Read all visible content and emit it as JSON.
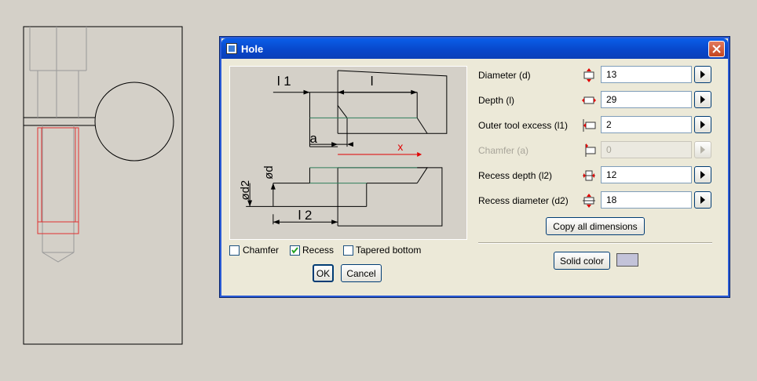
{
  "dialog": {
    "title": "Hole",
    "close_label": "×"
  },
  "preview": {
    "labels": {
      "l1": "l 1",
      "l": "l",
      "a": "a",
      "x": "x",
      "d": "ød",
      "d2": "ød2",
      "l2": "l 2"
    }
  },
  "options": {
    "chamfer": {
      "label": "Chamfer",
      "checked": false
    },
    "recess": {
      "label": "Recess",
      "checked": true
    },
    "tapered": {
      "label": "Tapered bottom",
      "checked": false
    }
  },
  "buttons": {
    "ok": "OK",
    "cancel": "Cancel",
    "copy_all": "Copy all dimensions",
    "solid_color": "Solid color"
  },
  "params": {
    "diameter": {
      "label": "Diameter (d)",
      "value": "13"
    },
    "depth": {
      "label": "Depth (l)",
      "value": "29"
    },
    "outer_tool_excess": {
      "label": "Outer tool excess (l1)",
      "value": "2"
    },
    "chamfer": {
      "label": "Chamfer  (a)",
      "value": "0"
    },
    "recess_depth": {
      "label": "Recess depth (l2)",
      "value": "12"
    },
    "recess_diameter": {
      "label": "Recess diameter (d2)",
      "value": "18"
    }
  },
  "colors": {
    "title_bar": "#0846c9",
    "solid_color_swatch": "#c3c3d9",
    "preview_red": "#e00000",
    "preview_green": "#2e7d5a"
  }
}
